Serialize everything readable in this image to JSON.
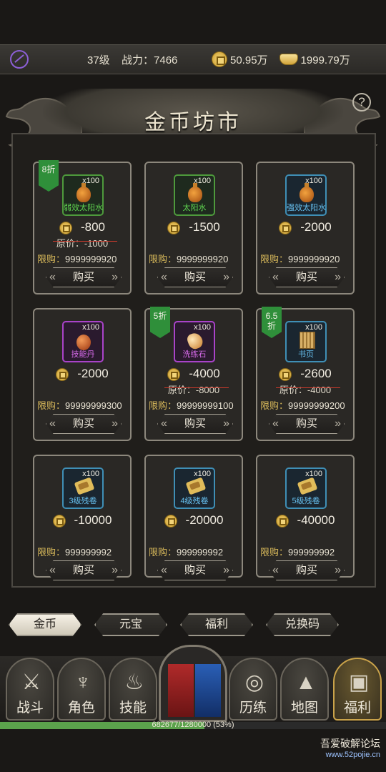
{
  "topbar": {
    "level": "37级",
    "power_label": "战力：",
    "power_value": "7466",
    "gold": "50.95万",
    "ingot": "1999.79万"
  },
  "title": "金币坊市",
  "help": "?",
  "items": [
    {
      "name": "弱效太阳水",
      "qty": "x100",
      "price": "-800",
      "orig": "原价：-1000",
      "limit_label": "限购：",
      "limit": "9999999920",
      "badge": "8折",
      "rarity": "green",
      "glyph": "bottle"
    },
    {
      "name": "太阳水",
      "qty": "x100",
      "price": "-1500",
      "orig": "",
      "limit_label": "限购：",
      "limit": "9999999920",
      "badge": "",
      "rarity": "green",
      "glyph": "bottle"
    },
    {
      "name": "强效太阳水",
      "qty": "x100",
      "price": "-2000",
      "orig": "",
      "limit_label": "限购：",
      "limit": "9999999920",
      "badge": "",
      "rarity": "blue",
      "glyph": "bottle"
    },
    {
      "name": "技能丹",
      "qty": "x100",
      "price": "-2000",
      "orig": "",
      "limit_label": "限购：",
      "limit": "99999999300",
      "badge": "",
      "rarity": "purple",
      "glyph": "ball"
    },
    {
      "name": "洗练石",
      "qty": "x100",
      "price": "-4000",
      "orig": "原价：-8000",
      "limit_label": "限购：",
      "limit": "99999999100",
      "badge": "5折",
      "rarity": "purple",
      "glyph": "stone"
    },
    {
      "name": "书页",
      "qty": "x100",
      "price": "-2600",
      "orig": "原价：-4000",
      "limit_label": "限购：",
      "limit": "99999999200",
      "badge": "6.5\n折",
      "rarity": "blue",
      "glyph": "book"
    },
    {
      "name": "3级残卷",
      "qty": "x100",
      "price": "-10000",
      "orig": "",
      "limit_label": "限购：",
      "limit": "999999992",
      "badge": "",
      "rarity": "blue",
      "glyph": "scroll"
    },
    {
      "name": "4级残卷",
      "qty": "x100",
      "price": "-20000",
      "orig": "",
      "limit_label": "限购：",
      "limit": "999999992",
      "badge": "",
      "rarity": "blue",
      "glyph": "scroll"
    },
    {
      "name": "5级残卷",
      "qty": "x100",
      "price": "-40000",
      "orig": "",
      "limit_label": "限购：",
      "limit": "999999992",
      "badge": "",
      "rarity": "blue",
      "glyph": "scroll"
    }
  ],
  "buy_label": "购买",
  "tabs": [
    {
      "label": "金币",
      "active": true
    },
    {
      "label": "元宝",
      "active": false
    },
    {
      "label": "福利",
      "active": false
    },
    {
      "label": "兑换码",
      "active": false
    }
  ],
  "nav": [
    {
      "label": "战斗",
      "icon": "swords-icon",
      "glyph": "⚔",
      "active": false
    },
    {
      "label": "角色",
      "icon": "helmet-icon",
      "glyph": "♆",
      "active": false
    },
    {
      "label": "技能",
      "icon": "flame-icon",
      "glyph": "♨",
      "active": false
    },
    {
      "label": "历练",
      "icon": "spiral-icon",
      "glyph": "◎",
      "active": false
    },
    {
      "label": "地图",
      "icon": "mountain-icon",
      "glyph": "▲",
      "active": false
    },
    {
      "label": "福利",
      "icon": "chest-icon",
      "glyph": "▣",
      "active": true
    }
  ],
  "exp": {
    "text": "682677/1280000 (53%)",
    "fraction": 0.53
  },
  "watermark": {
    "line1": "吾爱破解论坛",
    "line2": "www.52pojie.cn"
  },
  "colors": {
    "rarity_green": "#4e9a3c",
    "rarity_blue": "#3f8fb6",
    "rarity_purple": "#a943c9",
    "badge": "#2f8f3a",
    "strike": "#d23b2c"
  }
}
